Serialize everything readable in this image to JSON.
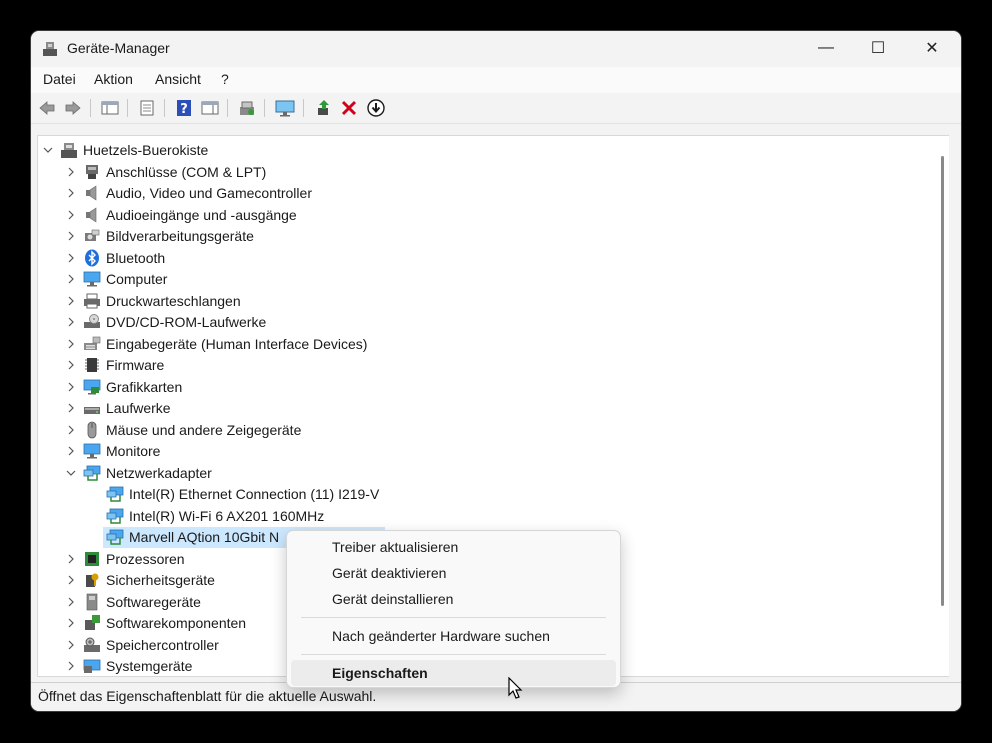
{
  "window": {
    "title": "Geräte-Manager"
  },
  "controls": {
    "minimize": "—",
    "maximize": "☐",
    "close": "✕"
  },
  "menu": [
    "Datei",
    "Aktion",
    "Ansicht",
    "?"
  ],
  "tree": {
    "root": "Huetzels-Buerokiste",
    "categories": [
      {
        "label": "Anschlüsse (COM & LPT)",
        "icon": "port-icon"
      },
      {
        "label": "Audio, Video und Gamecontroller",
        "icon": "speaker-icon"
      },
      {
        "label": "Audioeingänge und -ausgänge",
        "icon": "speaker-icon"
      },
      {
        "label": "Bildverarbeitungsgeräte",
        "icon": "camera-icon"
      },
      {
        "label": "Bluetooth",
        "icon": "bluetooth-icon"
      },
      {
        "label": "Computer",
        "icon": "monitor-icon"
      },
      {
        "label": "Druckwarteschlangen",
        "icon": "printer-icon"
      },
      {
        "label": "DVD/CD-ROM-Laufwerke",
        "icon": "disc-drive-icon"
      },
      {
        "label": "Eingabegeräte (Human Interface Devices)",
        "icon": "hid-icon"
      },
      {
        "label": "Firmware",
        "icon": "chip-icon"
      },
      {
        "label": "Grafikkarten",
        "icon": "display-adapter-icon"
      },
      {
        "label": "Laufwerke",
        "icon": "drive-icon"
      },
      {
        "label": "Mäuse und andere Zeigegeräte",
        "icon": "mouse-icon"
      },
      {
        "label": "Monitore",
        "icon": "monitor-icon"
      },
      {
        "label": "Netzwerkadapter",
        "icon": "network-icon"
      }
    ],
    "network_children": [
      "Intel(R) Ethernet Connection (11) I219-V",
      "Intel(R) Wi-Fi 6 AX201 160MHz",
      "Marvell AQtion 10Gbit N"
    ],
    "categories_after": [
      {
        "label": "Prozessoren",
        "icon": "processor-icon"
      },
      {
        "label": "Sicherheitsgeräte",
        "icon": "security-icon"
      },
      {
        "label": "Softwaregeräte",
        "icon": "software-device-icon"
      },
      {
        "label": "Softwarekomponenten",
        "icon": "component-icon"
      },
      {
        "label": "Speichercontroller",
        "icon": "storage-icon"
      },
      {
        "label": "Systemgeräte",
        "icon": "system-icon"
      }
    ]
  },
  "context_menu": {
    "items": [
      "Treiber aktualisieren",
      "Gerät deaktivieren",
      "Gerät deinstallieren",
      "Nach geänderter Hardware suchen",
      "Eigenschaften"
    ]
  },
  "status": "Öffnet das Eigenschaftenblatt für die aktuelle Auswahl.",
  "colors": {
    "selection": "#cce8ff",
    "accent": "#0078d4",
    "delete": "#d0021b"
  }
}
